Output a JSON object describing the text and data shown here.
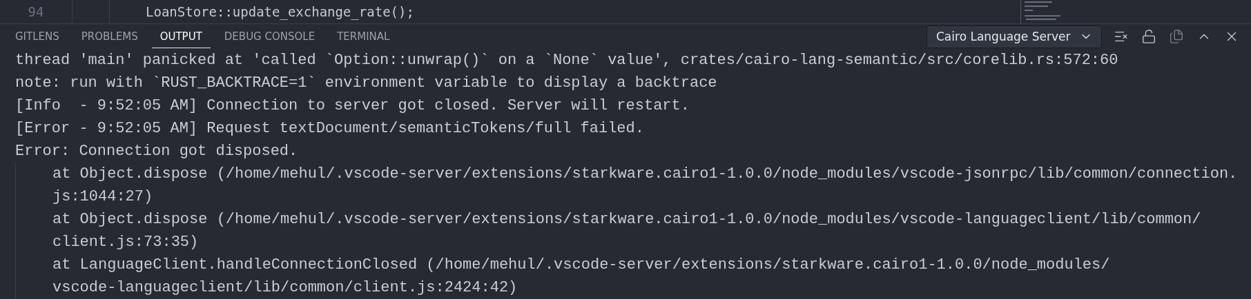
{
  "editor": {
    "line_number": "94",
    "code": "LoanStore::update_exchange_rate();"
  },
  "tabs": [
    {
      "label": "GITLENS",
      "selected": false
    },
    {
      "label": "PROBLEMS",
      "selected": false
    },
    {
      "label": "OUTPUT",
      "selected": true
    },
    {
      "label": "DEBUG CONSOLE",
      "selected": false
    },
    {
      "label": "TERMINAL",
      "selected": false
    }
  ],
  "channel_select": {
    "value": "Cairo Language Server"
  },
  "output": [
    {
      "kind": "plain",
      "lines": [
        "thread 'main' panicked at 'called `Option::unwrap()` on a `None` value', crates/cairo-lang-semantic/src/corelib.rs:572:60"
      ]
    },
    {
      "kind": "plain",
      "lines": [
        "note: run with `RUST_BACKTRACE=1` environment variable to display a backtrace"
      ]
    },
    {
      "kind": "plain",
      "lines": [
        "[Info  - 9:52:05 AM] Connection to server got closed. Server will restart."
      ]
    },
    {
      "kind": "plain",
      "lines": [
        "[Error - 9:52:05 AM] Request textDocument/semanticTokens/full failed."
      ]
    },
    {
      "kind": "plain",
      "lines": [
        "Error: Connection got disposed."
      ]
    },
    {
      "kind": "stack",
      "lines": [
        "at Object.dispose (/home/mehul/.vscode-server/extensions/starkware.cairo1-1.0.0/node_modules/vscode-jsonrpc/lib/common/connection.",
        "js:1044:27)"
      ]
    },
    {
      "kind": "stack",
      "lines": [
        "at Object.dispose (/home/mehul/.vscode-server/extensions/starkware.cairo1-1.0.0/node_modules/vscode-languageclient/lib/common/",
        "client.js:73:35)"
      ]
    },
    {
      "kind": "stack",
      "lines": [
        "at LanguageClient.handleConnectionClosed (/home/mehul/.vscode-server/extensions/starkware.cairo1-1.0.0/node_modules/",
        "vscode-languageclient/lib/common/client.js:2424:42)"
      ]
    }
  ]
}
